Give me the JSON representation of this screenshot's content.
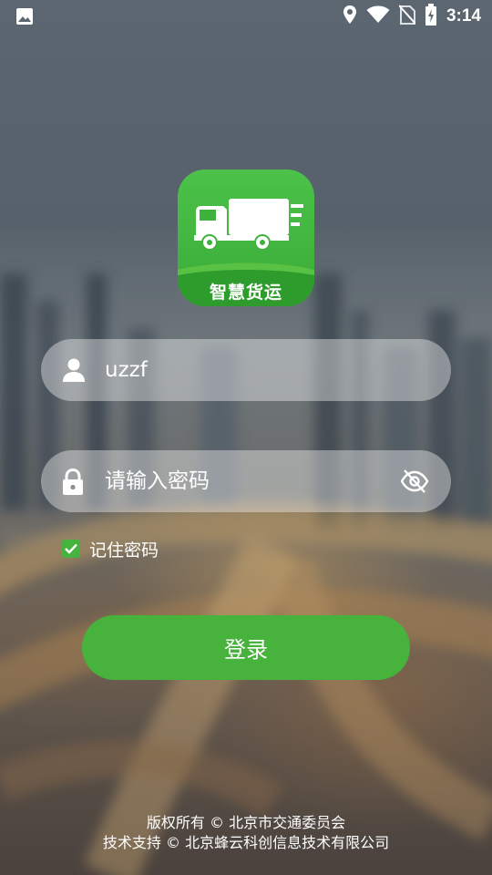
{
  "status_bar": {
    "time": "3:14",
    "icons": [
      "gallery-icon",
      "location-icon",
      "wifi-icon",
      "no-sim-icon",
      "battery-charging-icon"
    ]
  },
  "logo": {
    "text": "智慧货运",
    "icon": "truck-icon",
    "brand_color": "#45b33d"
  },
  "login": {
    "username": {
      "value": "uzzf",
      "icon": "user-icon"
    },
    "password": {
      "value": "",
      "placeholder": "请输入密码",
      "icon": "lock-icon",
      "toggle_icon": "eye-off-icon"
    },
    "remember": {
      "label": "记住密码",
      "checked": true
    },
    "submit_label": "登录"
  },
  "footer": {
    "line1": "版权所有 © 北京市交通委员会",
    "line2": "技术支持 © 北京蜂云科创信息技术有限公司"
  }
}
